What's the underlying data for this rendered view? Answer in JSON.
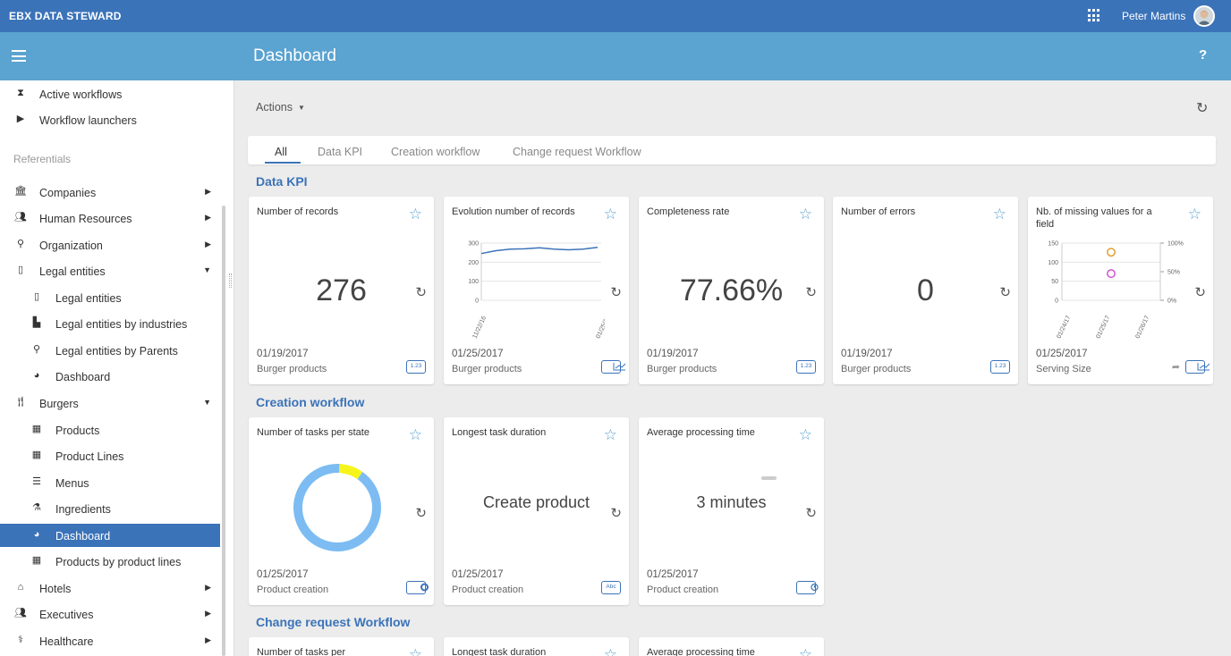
{
  "topbar": {
    "brand": "EBX DATA STEWARD",
    "user": "Peter Martins",
    "apps_icon": "apps-grid-icon",
    "avatar": "user-avatar"
  },
  "header": {
    "title": "Dashboard",
    "help": "?"
  },
  "sidebar": {
    "items": [
      {
        "label": "Active workflows",
        "icon": "hourglass-icon"
      },
      {
        "label": "Workflow launchers",
        "icon": "play-icon"
      }
    ],
    "section_label": "Referentials",
    "tree": [
      {
        "label": "Companies",
        "icon": "bank-icon"
      },
      {
        "label": "Human Resources",
        "icon": "users-icon"
      },
      {
        "label": "Organization",
        "icon": "org-icon"
      },
      {
        "label": "Legal entities",
        "icon": "building-icon"
      },
      {
        "label": "Legal entities",
        "icon": "building-icon"
      },
      {
        "label": "Legal entities by industries",
        "icon": "industry-icon"
      },
      {
        "label": "Legal entities by Parents",
        "icon": "org-icon"
      },
      {
        "label": "Dashboard",
        "icon": "pie-icon"
      },
      {
        "label": "Burgers",
        "icon": "cutlery-icon"
      },
      {
        "label": "Products",
        "icon": "grid-icon"
      },
      {
        "label": "Product Lines",
        "icon": "grid-icon"
      },
      {
        "label": "Menus",
        "icon": "list-icon"
      },
      {
        "label": "Ingredients",
        "icon": "flask-icon"
      },
      {
        "label": "Dashboard",
        "icon": "pie-icon"
      },
      {
        "label": "Products by product lines",
        "icon": "grid-icon"
      },
      {
        "label": "Hotels",
        "icon": "home-icon"
      },
      {
        "label": "Executives",
        "icon": "users-icon"
      },
      {
        "label": "Healthcare",
        "icon": "stethoscope-icon"
      }
    ]
  },
  "toolbar": {
    "actions_label": "Actions"
  },
  "tabs": [
    "All",
    "Data KPI",
    "Creation workflow",
    "Change request Workflow"
  ],
  "sections": {
    "data_kpi": "Data KPI",
    "creation": "Creation workflow",
    "change_request": "Change request Workflow"
  },
  "kpi_cards": [
    {
      "title": "Number of records",
      "value": "276",
      "date": "01/19/2017",
      "subtitle": "Burger products",
      "badge": "1.23"
    },
    {
      "title": "Evolution number of records",
      "date": "01/25/2017",
      "subtitle": "Burger products",
      "badge": "chart-icon"
    },
    {
      "title": "Completeness rate",
      "value": "77.66%",
      "date": "01/19/2017",
      "subtitle": "Burger products",
      "badge": "1.23"
    },
    {
      "title": "Number of errors",
      "value": "0",
      "date": "01/19/2017",
      "subtitle": "Burger products",
      "badge": "1.23"
    },
    {
      "title": "Nb. of missing values for a field",
      "date": "01/25/2017",
      "subtitle": "Serving Size",
      "badge": "chart-icon"
    }
  ],
  "creation_cards": [
    {
      "title": "Number of tasks per state",
      "date": "01/25/2017",
      "subtitle": "Product creation",
      "badge": "donut-icon"
    },
    {
      "title": "Longest task duration",
      "value": "Create product",
      "date": "01/25/2017",
      "subtitle": "Product creation",
      "badge": "Abc"
    },
    {
      "title": "Average processing time",
      "value": "3 minutes",
      "date": "01/25/2017",
      "subtitle": "Product creation",
      "badge": "clock-icon"
    }
  ],
  "change_cards": [
    {
      "title": "Number of tasks per"
    },
    {
      "title": "Longest task duration"
    },
    {
      "title": "Average processing time"
    }
  ],
  "chart_data": [
    {
      "type": "line",
      "x": [
        "11/22/16",
        "01/25/17"
      ],
      "y_ticks": [
        0,
        100,
        200,
        300
      ],
      "ylim": [
        0,
        300
      ],
      "series": [
        {
          "values": [
            245,
            260,
            268,
            270,
            275,
            268,
            265,
            268,
            278
          ]
        }
      ],
      "color": "#3b73b9"
    },
    {
      "type": "scatter",
      "x": [
        "01/24/17",
        "01/25/17",
        "01/26/17"
      ],
      "y_ticks_left": [
        0,
        50,
        100,
        150
      ],
      "y_ticks_right": [
        "0%",
        "50%",
        "100%"
      ],
      "points": [
        {
          "x": "01/25/17",
          "y": 126,
          "color": "#e0a030"
        },
        {
          "x": "01/25/17",
          "y": 70,
          "color": "#d050d0"
        }
      ]
    },
    {
      "type": "pie",
      "slices": [
        {
          "value": 0.91,
          "color": "#7cbcf2"
        },
        {
          "value": 0.09,
          "color": "#f5f51c"
        }
      ]
    }
  ]
}
